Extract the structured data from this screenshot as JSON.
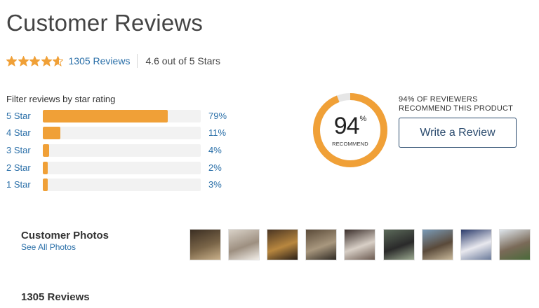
{
  "header": {
    "title": "Customer Reviews"
  },
  "summary": {
    "rating": 4.6,
    "review_count_label": "1305 Reviews",
    "rating_text": "4.6 out of 5 Stars",
    "star_color": "#f0a037"
  },
  "filter": {
    "title": "Filter reviews by star rating",
    "rows": [
      {
        "label": "5 Star",
        "percent_label": "79%",
        "percent": 79
      },
      {
        "label": "4 Star",
        "percent_label": "11%",
        "percent": 11
      },
      {
        "label": "3 Star",
        "percent_label": "4%",
        "percent": 4
      },
      {
        "label": "2 Star",
        "percent_label": "2%",
        "percent": 2
      },
      {
        "label": "1 Star",
        "percent_label": "3%",
        "percent": 3
      }
    ],
    "bar_color": "#f0a037"
  },
  "recommend": {
    "value": "94",
    "percent_sign": "%",
    "percent": 94,
    "sub_label": "RECOMMEND",
    "text_line1": "94% OF REVIEWERS",
    "text_line2": "RECOMMEND THIS PRODUCT",
    "ring_color": "#f0a037",
    "ring_track_color": "#e6e6e6"
  },
  "actions": {
    "write_review_label": "Write a Review"
  },
  "photos": {
    "title": "Customer Photos",
    "see_all_label": "See All Photos",
    "thumbnails": [
      {
        "name": "photo-1",
        "colors": [
          "#3b2e22",
          "#7a6548",
          "#c9b08a"
        ]
      },
      {
        "name": "photo-2",
        "colors": [
          "#d9d2c8",
          "#9d8f80",
          "#f2eee8"
        ]
      },
      {
        "name": "photo-3",
        "colors": [
          "#4a3522",
          "#b8873f",
          "#2b2018"
        ]
      },
      {
        "name": "photo-4",
        "colors": [
          "#5a4a38",
          "#a8977e",
          "#2f2a24"
        ]
      },
      {
        "name": "photo-5",
        "colors": [
          "#3a2e2a",
          "#d8cfc6",
          "#6b5a50"
        ]
      },
      {
        "name": "photo-6",
        "colors": [
          "#5c6a5a",
          "#2a2a2a",
          "#9aa88f"
        ]
      },
      {
        "name": "photo-7",
        "colors": [
          "#7a9bb8",
          "#5a4a3a",
          "#c8b89a"
        ]
      },
      {
        "name": "photo-8",
        "colors": [
          "#2a3a6a",
          "#e8e8ee",
          "#6a7a9a"
        ]
      },
      {
        "name": "photo-9",
        "colors": [
          "#dfe6ec",
          "#7a6a58",
          "#4a6a3a"
        ]
      }
    ]
  },
  "reviews": {
    "heading": "1305 Reviews"
  }
}
